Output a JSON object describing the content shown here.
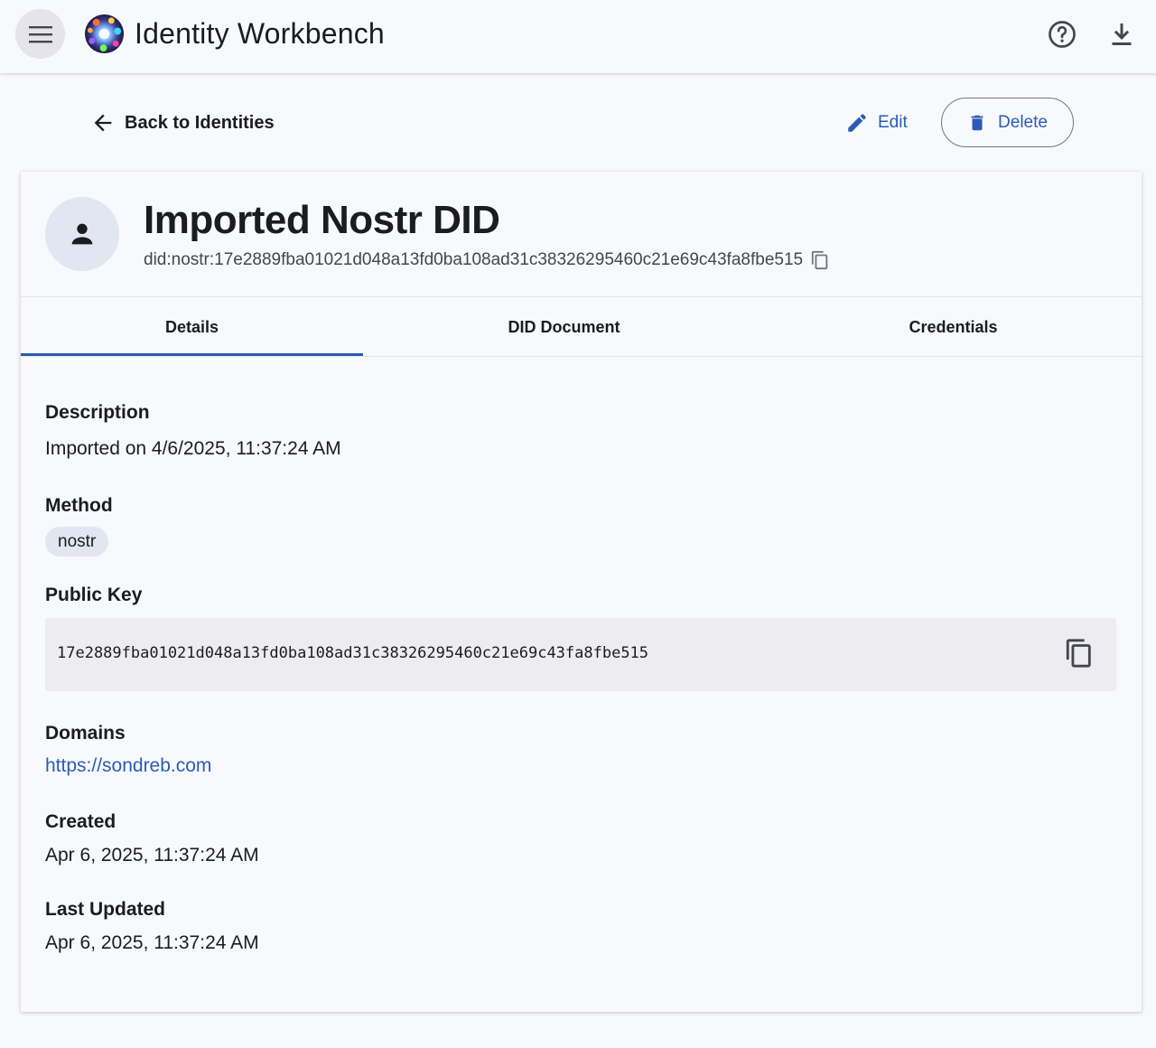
{
  "app": {
    "title": "Identity Workbench",
    "icons": {
      "menu": "menu-icon",
      "logo": "app-logo",
      "help": "help-circle-icon",
      "download": "download-icon"
    }
  },
  "actions": {
    "back_label": "Back to Identities",
    "edit_label": "Edit",
    "delete_label": "Delete"
  },
  "identity": {
    "name": "Imported Nostr DID",
    "did": "did:nostr:17e2889fba01021d048a13fd0ba108ad31c38326295460c21e69c43fa8fbe515"
  },
  "tabs": [
    {
      "label": "Details",
      "selected": true
    },
    {
      "label": "DID Document",
      "selected": false
    },
    {
      "label": "Credentials",
      "selected": false
    }
  ],
  "details": {
    "description_label": "Description",
    "description_value": "Imported on 4/6/2025, 11:37:24 AM",
    "method_label": "Method",
    "method_value": "nostr",
    "public_key_label": "Public Key",
    "public_key_value": "17e2889fba01021d048a13fd0ba108ad31c38326295460c21e69c43fa8fbe515",
    "domains_label": "Domains",
    "domains": [
      "https://sondreb.com"
    ],
    "created_label": "Created",
    "created_value": "Apr 6, 2025, 11:37:24 AM",
    "updated_label": "Last Updated",
    "updated_value": "Apr 6, 2025, 11:37:24 AM"
  },
  "colors": {
    "accent": "#2a5cb5",
    "background": "#f8f9fd",
    "chip": "#e1e6f1"
  }
}
